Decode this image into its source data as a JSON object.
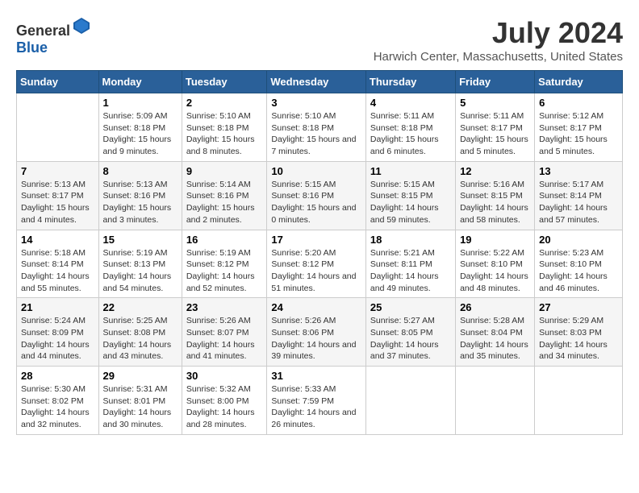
{
  "header": {
    "logo_general": "General",
    "logo_blue": "Blue",
    "month": "July 2024",
    "location": "Harwich Center, Massachusetts, United States"
  },
  "calendar": {
    "days_of_week": [
      "Sunday",
      "Monday",
      "Tuesday",
      "Wednesday",
      "Thursday",
      "Friday",
      "Saturday"
    ],
    "weeks": [
      [
        {
          "day": "",
          "content": ""
        },
        {
          "day": "1",
          "content": "Sunrise: 5:09 AM\nSunset: 8:18 PM\nDaylight: 15 hours\nand 9 minutes."
        },
        {
          "day": "2",
          "content": "Sunrise: 5:10 AM\nSunset: 8:18 PM\nDaylight: 15 hours\nand 8 minutes."
        },
        {
          "day": "3",
          "content": "Sunrise: 5:10 AM\nSunset: 8:18 PM\nDaylight: 15 hours\nand 7 minutes."
        },
        {
          "day": "4",
          "content": "Sunrise: 5:11 AM\nSunset: 8:18 PM\nDaylight: 15 hours\nand 6 minutes."
        },
        {
          "day": "5",
          "content": "Sunrise: 5:11 AM\nSunset: 8:17 PM\nDaylight: 15 hours\nand 5 minutes."
        },
        {
          "day": "6",
          "content": "Sunrise: 5:12 AM\nSunset: 8:17 PM\nDaylight: 15 hours\nand 5 minutes."
        }
      ],
      [
        {
          "day": "7",
          "content": "Sunrise: 5:13 AM\nSunset: 8:17 PM\nDaylight: 15 hours\nand 4 minutes."
        },
        {
          "day": "8",
          "content": "Sunrise: 5:13 AM\nSunset: 8:16 PM\nDaylight: 15 hours\nand 3 minutes."
        },
        {
          "day": "9",
          "content": "Sunrise: 5:14 AM\nSunset: 8:16 PM\nDaylight: 15 hours\nand 2 minutes."
        },
        {
          "day": "10",
          "content": "Sunrise: 5:15 AM\nSunset: 8:16 PM\nDaylight: 15 hours\nand 0 minutes."
        },
        {
          "day": "11",
          "content": "Sunrise: 5:15 AM\nSunset: 8:15 PM\nDaylight: 14 hours\nand 59 minutes."
        },
        {
          "day": "12",
          "content": "Sunrise: 5:16 AM\nSunset: 8:15 PM\nDaylight: 14 hours\nand 58 minutes."
        },
        {
          "day": "13",
          "content": "Sunrise: 5:17 AM\nSunset: 8:14 PM\nDaylight: 14 hours\nand 57 minutes."
        }
      ],
      [
        {
          "day": "14",
          "content": "Sunrise: 5:18 AM\nSunset: 8:14 PM\nDaylight: 14 hours\nand 55 minutes."
        },
        {
          "day": "15",
          "content": "Sunrise: 5:19 AM\nSunset: 8:13 PM\nDaylight: 14 hours\nand 54 minutes."
        },
        {
          "day": "16",
          "content": "Sunrise: 5:19 AM\nSunset: 8:12 PM\nDaylight: 14 hours\nand 52 minutes."
        },
        {
          "day": "17",
          "content": "Sunrise: 5:20 AM\nSunset: 8:12 PM\nDaylight: 14 hours\nand 51 minutes."
        },
        {
          "day": "18",
          "content": "Sunrise: 5:21 AM\nSunset: 8:11 PM\nDaylight: 14 hours\nand 49 minutes."
        },
        {
          "day": "19",
          "content": "Sunrise: 5:22 AM\nSunset: 8:10 PM\nDaylight: 14 hours\nand 48 minutes."
        },
        {
          "day": "20",
          "content": "Sunrise: 5:23 AM\nSunset: 8:10 PM\nDaylight: 14 hours\nand 46 minutes."
        }
      ],
      [
        {
          "day": "21",
          "content": "Sunrise: 5:24 AM\nSunset: 8:09 PM\nDaylight: 14 hours\nand 44 minutes."
        },
        {
          "day": "22",
          "content": "Sunrise: 5:25 AM\nSunset: 8:08 PM\nDaylight: 14 hours\nand 43 minutes."
        },
        {
          "day": "23",
          "content": "Sunrise: 5:26 AM\nSunset: 8:07 PM\nDaylight: 14 hours\nand 41 minutes."
        },
        {
          "day": "24",
          "content": "Sunrise: 5:26 AM\nSunset: 8:06 PM\nDaylight: 14 hours\nand 39 minutes."
        },
        {
          "day": "25",
          "content": "Sunrise: 5:27 AM\nSunset: 8:05 PM\nDaylight: 14 hours\nand 37 minutes."
        },
        {
          "day": "26",
          "content": "Sunrise: 5:28 AM\nSunset: 8:04 PM\nDaylight: 14 hours\nand 35 minutes."
        },
        {
          "day": "27",
          "content": "Sunrise: 5:29 AM\nSunset: 8:03 PM\nDaylight: 14 hours\nand 34 minutes."
        }
      ],
      [
        {
          "day": "28",
          "content": "Sunrise: 5:30 AM\nSunset: 8:02 PM\nDaylight: 14 hours\nand 32 minutes."
        },
        {
          "day": "29",
          "content": "Sunrise: 5:31 AM\nSunset: 8:01 PM\nDaylight: 14 hours\nand 30 minutes."
        },
        {
          "day": "30",
          "content": "Sunrise: 5:32 AM\nSunset: 8:00 PM\nDaylight: 14 hours\nand 28 minutes."
        },
        {
          "day": "31",
          "content": "Sunrise: 5:33 AM\nSunset: 7:59 PM\nDaylight: 14 hours\nand 26 minutes."
        },
        {
          "day": "",
          "content": ""
        },
        {
          "day": "",
          "content": ""
        },
        {
          "day": "",
          "content": ""
        }
      ]
    ]
  }
}
